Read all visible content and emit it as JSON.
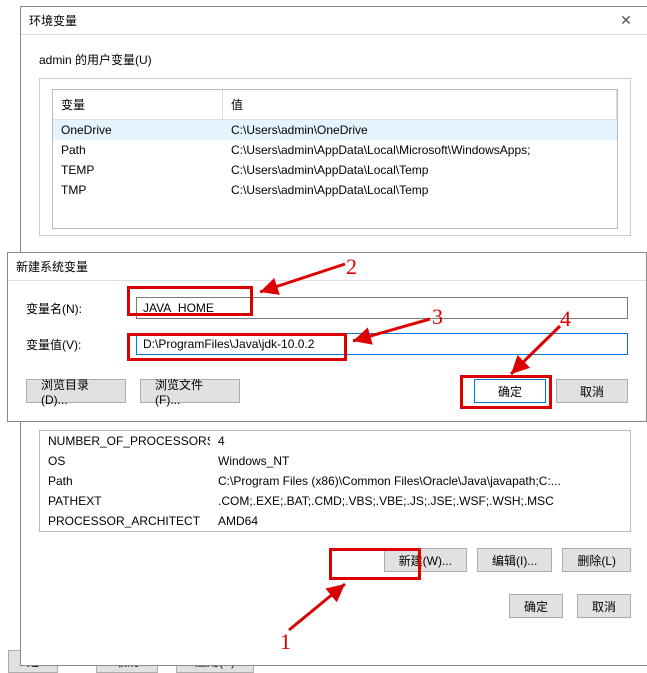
{
  "env_window": {
    "title": "环境变量",
    "close_glyph": "✕",
    "user_section_label": "admin 的用户变量(U)",
    "header_var": "变量",
    "header_val": "值",
    "user_vars": [
      {
        "name": "OneDrive",
        "value": "C:\\Users\\admin\\OneDrive"
      },
      {
        "name": "Path",
        "value": "C:\\Users\\admin\\AppData\\Local\\Microsoft\\WindowsApps;"
      },
      {
        "name": "TEMP",
        "value": "C:\\Users\\admin\\AppData\\Local\\Temp"
      },
      {
        "name": "TMP",
        "value": "C:\\Users\\admin\\AppData\\Local\\Temp"
      }
    ]
  },
  "newvar_window": {
    "title": "新建系统变量",
    "name_label": "变量名(N):",
    "name_value": "JAVA_HOME",
    "value_label": "变量值(V):",
    "value_value": "D:\\ProgramFiles\\Java\\jdk-10.0.2",
    "browse_dir": "浏览目录(D)...",
    "browse_file": "浏览文件(F)...",
    "ok": "确定",
    "cancel": "取消"
  },
  "sys_vars": [
    {
      "name": "NUMBER_OF_PROCESSORS",
      "value": "4"
    },
    {
      "name": "OS",
      "value": "Windows_NT"
    },
    {
      "name": "Path",
      "value": "C:\\Program Files (x86)\\Common Files\\Oracle\\Java\\javapath;C:..."
    },
    {
      "name": "PATHEXT",
      "value": ".COM;.EXE;.BAT;.CMD;.VBS;.VBE;.JS;.JSE;.WSF;.WSH;.MSC"
    },
    {
      "name": "PROCESSOR_ARCHITECT",
      "value": "AMD64"
    }
  ],
  "sys_btns": {
    "new": "新建(W)...",
    "edit": "编辑(I)...",
    "delete": "删除(L)"
  },
  "final": {
    "ok": "确定",
    "cancel": "取消"
  },
  "bg": {
    "a": "定",
    "b": "取消",
    "c": "应用(A)"
  },
  "annot": {
    "n1": "1",
    "n2": "2",
    "n3": "3",
    "n4": "4"
  }
}
